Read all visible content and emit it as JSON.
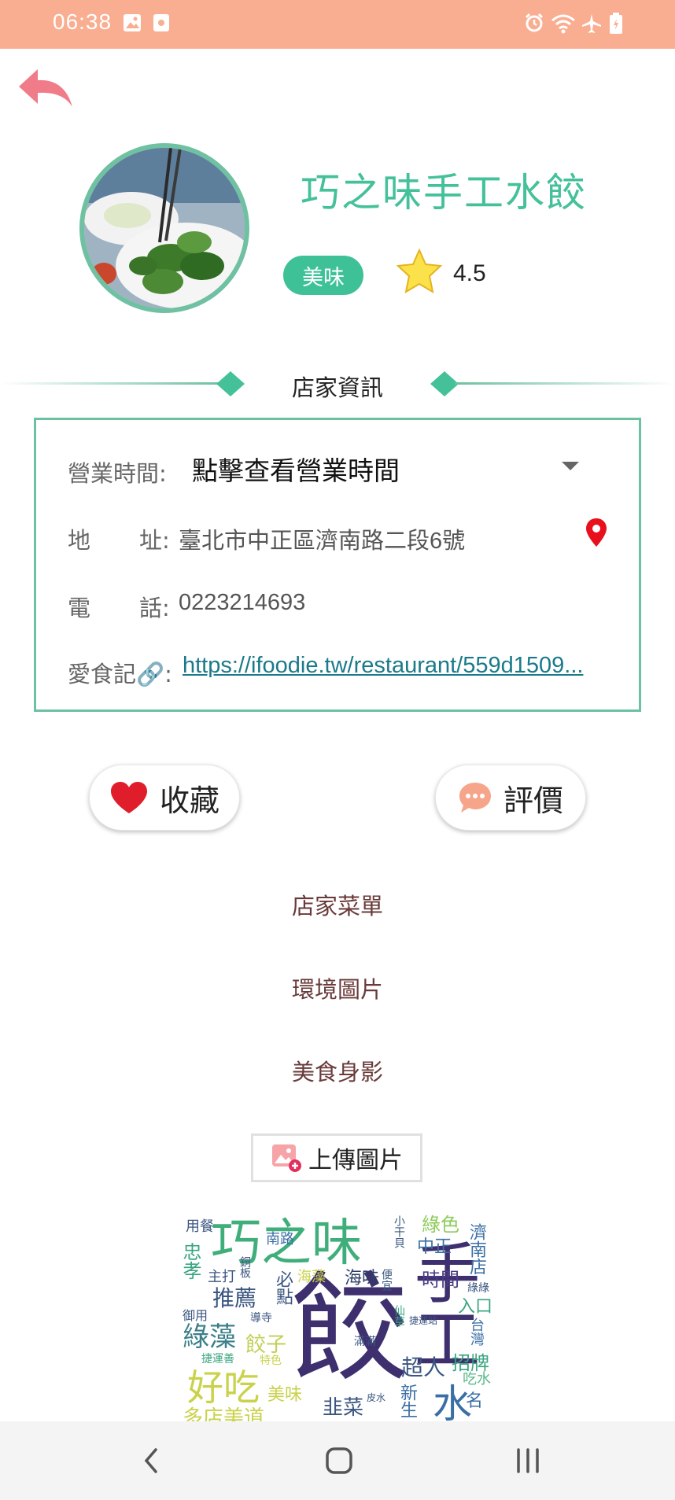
{
  "status_bar": {
    "time": "06:38"
  },
  "header": {
    "shop_name": "巧之味手工水餃",
    "tag": "美味",
    "rating": "4.5"
  },
  "section": {
    "title": "店家資訊"
  },
  "info": {
    "hours_label": "營業時間:",
    "hours_value": "點擊查看營業時間",
    "address_label_a": "地",
    "address_label_b": "址:",
    "address_value": "臺北市中正區濟南路二段6號",
    "phone_label_a": "電",
    "phone_label_b": "話:",
    "phone_value": "0223214693",
    "link_label": "愛食記🔗:",
    "link_value": "https://ifoodie.tw/restaurant/559d1509..."
  },
  "actions": {
    "favorite": "收藏",
    "review": "評價"
  },
  "links": {
    "menu": "店家菜單",
    "environment": "環境圖片",
    "food_photos": "美食身影"
  },
  "upload": {
    "label": "上傳圖片"
  },
  "wordcloud": {
    "words": [
      "巧之味",
      "餃",
      "手工",
      "水",
      "推薦",
      "綠藻",
      "好吃",
      "餃子",
      "美味",
      "海味",
      "時間",
      "超人",
      "招牌",
      "韭菜",
      "中正",
      "綠色",
      "濟南店",
      "入口",
      "吃水",
      "台灣",
      "忠孝",
      "主打",
      "用餐",
      "南路",
      "必點",
      "海藻",
      "便宜",
      "導寺",
      "御用",
      "捷運善",
      "特色",
      "滿滿",
      "新生",
      "名",
      "小干貝",
      "皮水",
      "銅板",
      "仙草",
      "捷運站",
      "多店美道",
      "綠綠"
    ]
  },
  "colors": {
    "status_bar": "#f9ae91",
    "accent": "#45c19a",
    "badge": "#3fc197",
    "link": "#1a7a8a",
    "menu_text": "#6a3a3a"
  }
}
